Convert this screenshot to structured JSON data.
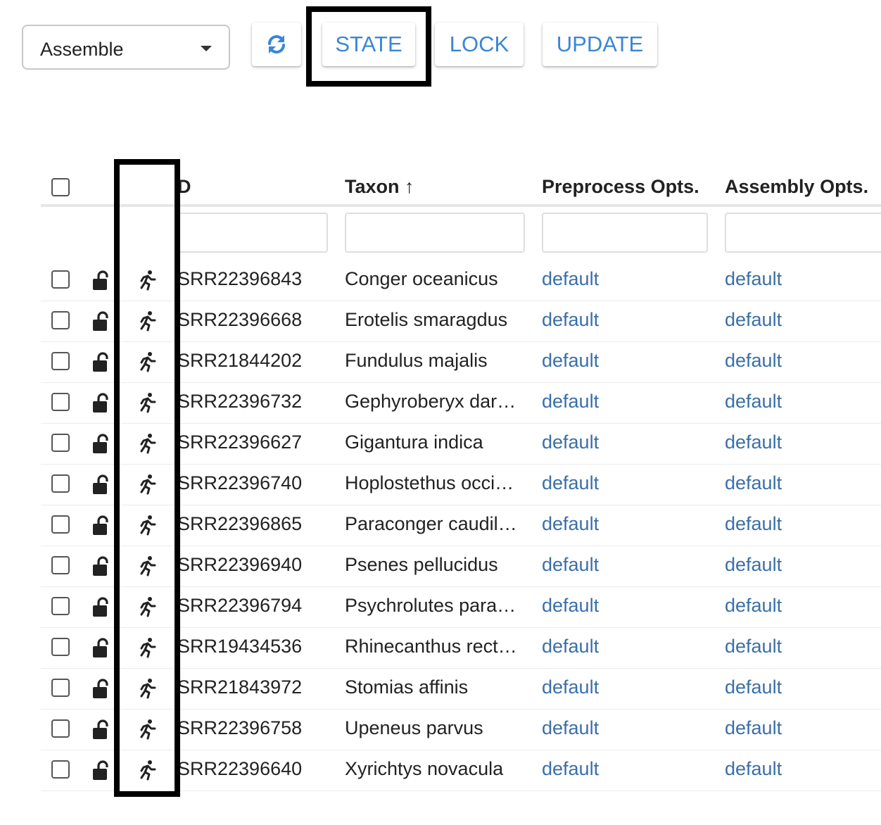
{
  "toolbar": {
    "mode_select": {
      "value": "Assemble"
    },
    "refresh_icon": "refresh-icon",
    "state_label": "STATE",
    "lock_label": "LOCK",
    "update_label": "UPDATE"
  },
  "table": {
    "columns": {
      "select_all": "",
      "id": "D",
      "taxon": "Taxon ↑",
      "preprocess": "Preprocess Opts.",
      "assembly": "Assembly Opts."
    },
    "rows": [
      {
        "id": "SRR22396843",
        "taxon": "Conger oceanicus",
        "preprocess": "default",
        "assembly": "default"
      },
      {
        "id": "SRR22396668",
        "taxon": "Erotelis smaragdus",
        "preprocess": "default",
        "assembly": "default"
      },
      {
        "id": "SRR21844202",
        "taxon": "Fundulus majalis",
        "preprocess": "default",
        "assembly": "default"
      },
      {
        "id": "SRR22396732",
        "taxon": "Gephyroberyx dar…",
        "preprocess": "default",
        "assembly": "default"
      },
      {
        "id": "SRR22396627",
        "taxon": "Gigantura indica",
        "preprocess": "default",
        "assembly": "default"
      },
      {
        "id": "SRR22396740",
        "taxon": "Hoplostethus occi…",
        "preprocess": "default",
        "assembly": "default"
      },
      {
        "id": "SRR22396865",
        "taxon": "Paraconger caudil…",
        "preprocess": "default",
        "assembly": "default"
      },
      {
        "id": "SRR22396940",
        "taxon": "Psenes pellucidus",
        "preprocess": "default",
        "assembly": "default"
      },
      {
        "id": "SRR22396794",
        "taxon": "Psychrolutes para…",
        "preprocess": "default",
        "assembly": "default"
      },
      {
        "id": "SRR19434536",
        "taxon": "Rhinecanthus rect…",
        "preprocess": "default",
        "assembly": "default"
      },
      {
        "id": "SRR21843972",
        "taxon": "Stomias affinis",
        "preprocess": "default",
        "assembly": "default"
      },
      {
        "id": "SRR22396758",
        "taxon": "Upeneus parvus",
        "preprocess": "default",
        "assembly": "default"
      },
      {
        "id": "SRR22396640",
        "taxon": "Xyrichtys novacula",
        "preprocess": "default",
        "assembly": "default"
      }
    ],
    "row_icons": {
      "lock": "unlocked-icon",
      "state": "running-icon"
    }
  },
  "colors": {
    "accent": "#3b86d6",
    "link": "#3a6fa8",
    "highlight": "#000000"
  }
}
